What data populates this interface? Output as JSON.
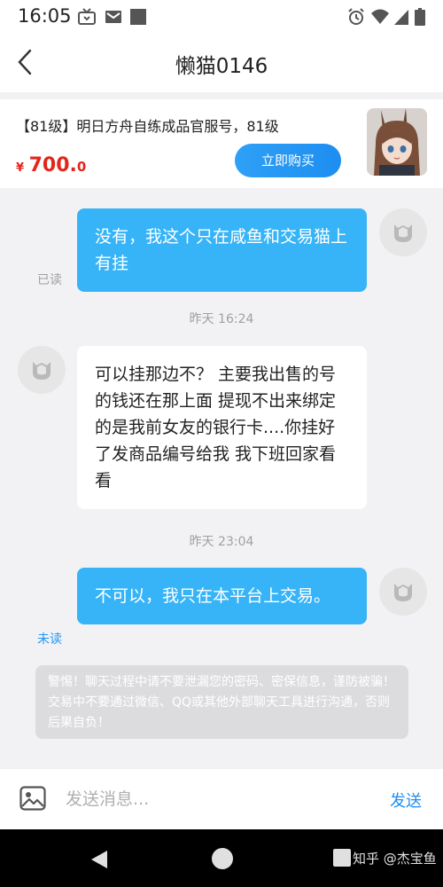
{
  "status_bar": {
    "time": "16:05",
    "left_icons": [
      "tv-icon",
      "gmail-icon",
      "square-notification-icon"
    ],
    "right_icons": [
      "alarm-icon",
      "wifi-icon",
      "signal-icon",
      "battery-icon"
    ]
  },
  "header": {
    "title": "懒猫0146",
    "back_icon": "chevron-left-icon"
  },
  "product": {
    "title": "【81级】明日方舟自练成品官服号，81级",
    "currency": "¥",
    "price_int": "700.",
    "price_dec": "0",
    "buy_label": "立即购买",
    "price_color": "#e3261b"
  },
  "chat": {
    "messages": [
      {
        "from": "me",
        "text": "没有，我这个只在咸鱼和交易猫上有挂",
        "status": "已读"
      },
      {
        "timestamp": "昨天 16:24"
      },
      {
        "from": "other",
        "text": "可以挂那边不？ 主要我出售的号的钱还在那上面 提现不出来绑定的是我前女友的银行卡....你挂好了发商品编号给我 我下班回家看看"
      },
      {
        "timestamp": "昨天 23:04"
      },
      {
        "from": "me",
        "text": "不可以，我只在本平台上交易。",
        "status": "未读"
      }
    ],
    "warning": "警惕！聊天过程中请不要泄漏您的密码、密保信息，谨防被骗！交易中不要通过微信、QQ或其他外部聊天工具进行沟通，否则后果自负！",
    "bubble_color": "#36b4f7",
    "unread_color": "#2196f3"
  },
  "input_bar": {
    "placeholder": "发送消息...",
    "send_label": "发送",
    "image_icon": "image-icon"
  },
  "nav_bar": {
    "watermark": "知乎 @杰宝鱼"
  }
}
